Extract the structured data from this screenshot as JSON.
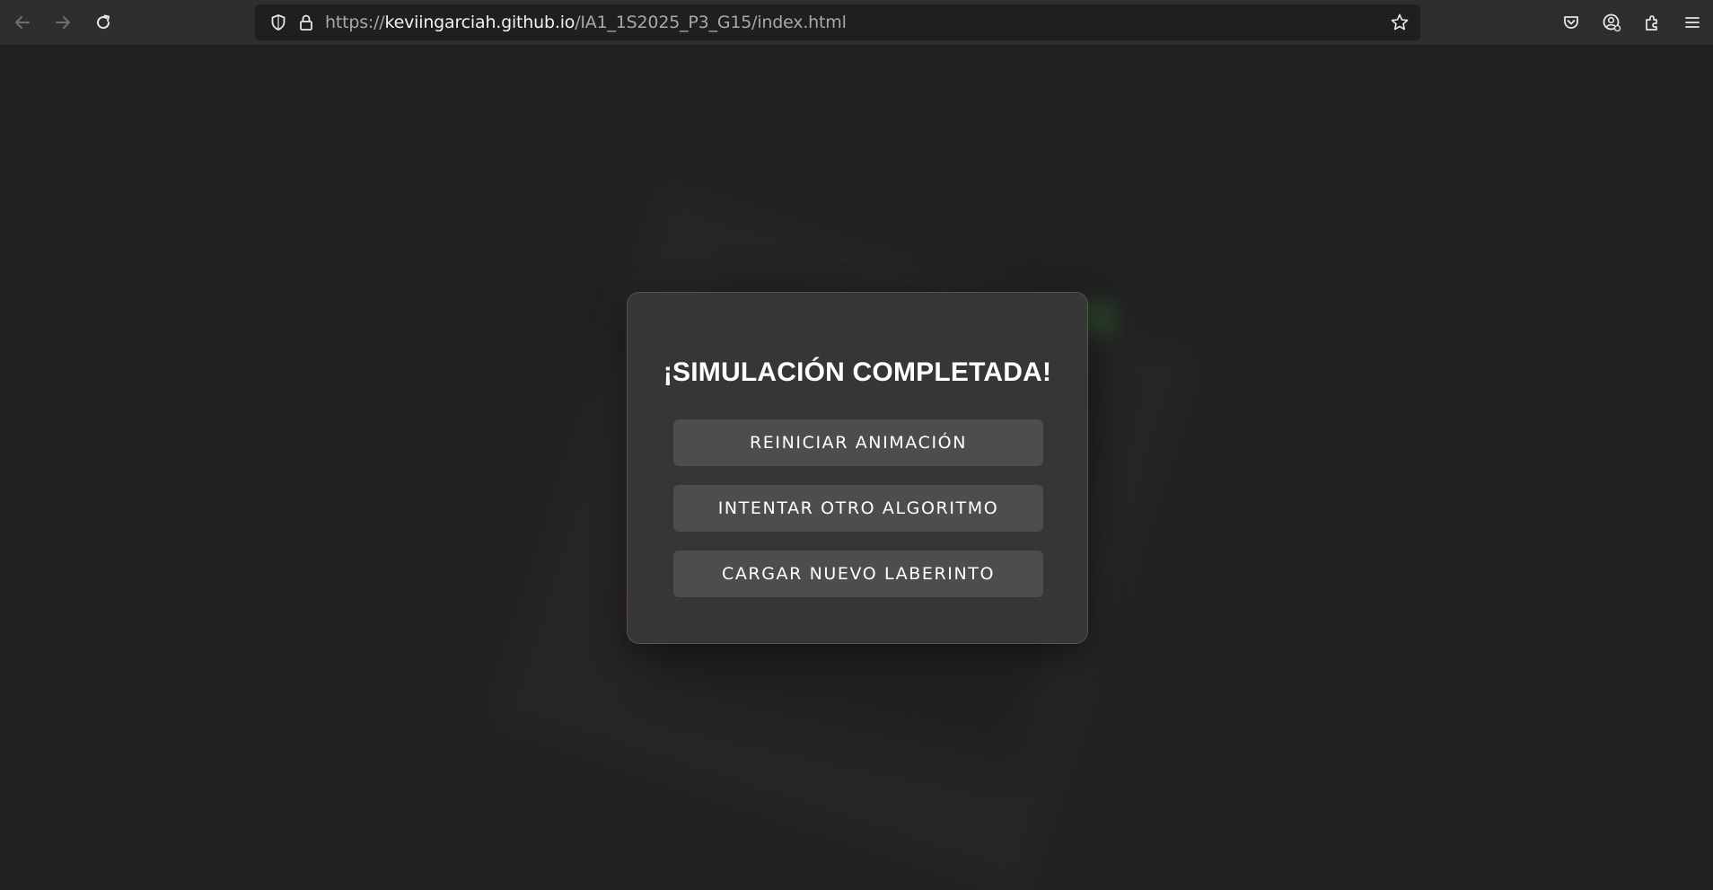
{
  "browser": {
    "url_prefix": "https://",
    "url_host": "keviingarciah.github.io",
    "url_path": "/IA1_1S2025_P3_G15/index.html",
    "icons": [
      "back-arrow-icon",
      "forward-arrow-icon",
      "reload-icon",
      "shield-icon",
      "lock-icon",
      "bookmark-star-icon",
      "pocket-icon",
      "account-icon",
      "extensions-icon",
      "menu-icon"
    ]
  },
  "modal": {
    "title": "¡SIMULACIÓN COMPLETADA!",
    "buttons": {
      "restart": "REINICIAR ANIMACIÓN",
      "other_algorithm": "INTENTAR OTRO ALGORITMO",
      "new_maze": "CARGAR NUEVO LABERINTO"
    }
  },
  "colors": {
    "page_background": "#212121",
    "modal_background": "#383838",
    "button_background": "#4d4d4d",
    "text": "#ffffff"
  }
}
